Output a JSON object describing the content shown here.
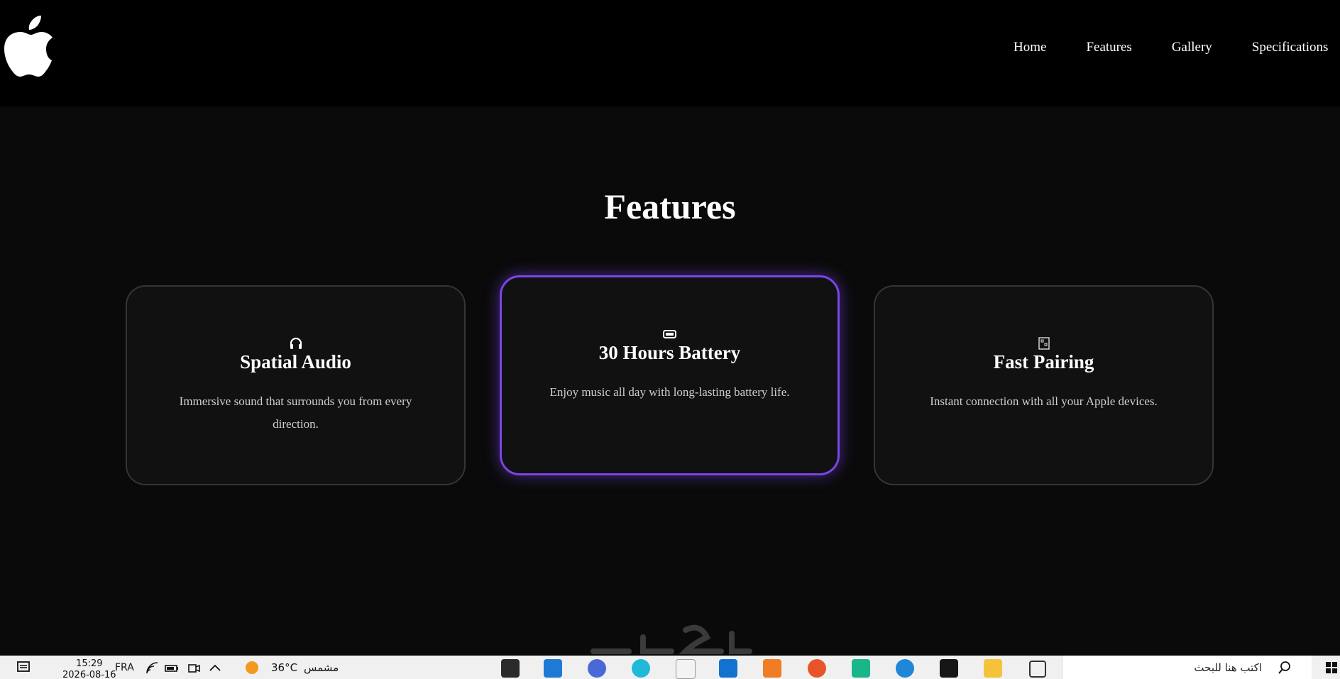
{
  "header": {
    "logo_icon": "apple-logo-icon",
    "nav": [
      {
        "label": "Home"
      },
      {
        "label": "Features"
      },
      {
        "label": "Gallery"
      },
      {
        "label": "Specifications"
      }
    ]
  },
  "features": {
    "title": "Features",
    "accent_color": "#7a45e8",
    "cards": [
      {
        "icon": "headphones-icon",
        "title": "Spatial Audio",
        "description": "Immersive sound that surrounds you from every direction.",
        "highlighted": false
      },
      {
        "icon": "battery-icon",
        "title": "30 Hours Battery",
        "description": "Enjoy music all day with long-lasting battery life.",
        "highlighted": true
      },
      {
        "icon": "broken-image-icon",
        "title": "Fast Pairing",
        "description": "Instant connection with all your Apple devices.",
        "highlighted": false
      }
    ]
  },
  "taskbar": {
    "time": "15:29",
    "date": "2026-08-16",
    "language": "FRA",
    "weather_temp": "36°C",
    "weather_text": "مشمس",
    "search_placeholder": "اكتب هنا للبحث",
    "apps": [
      "unity-icon",
      "vscode-icon",
      "chrome-icon",
      "canva-icon",
      "ai-icon",
      "outlook-icon",
      "xampp-icon",
      "firefox-icon",
      "pycharm-icon",
      "edge-icon",
      "github-icon",
      "file-explorer-icon",
      "task-view-icon"
    ]
  }
}
